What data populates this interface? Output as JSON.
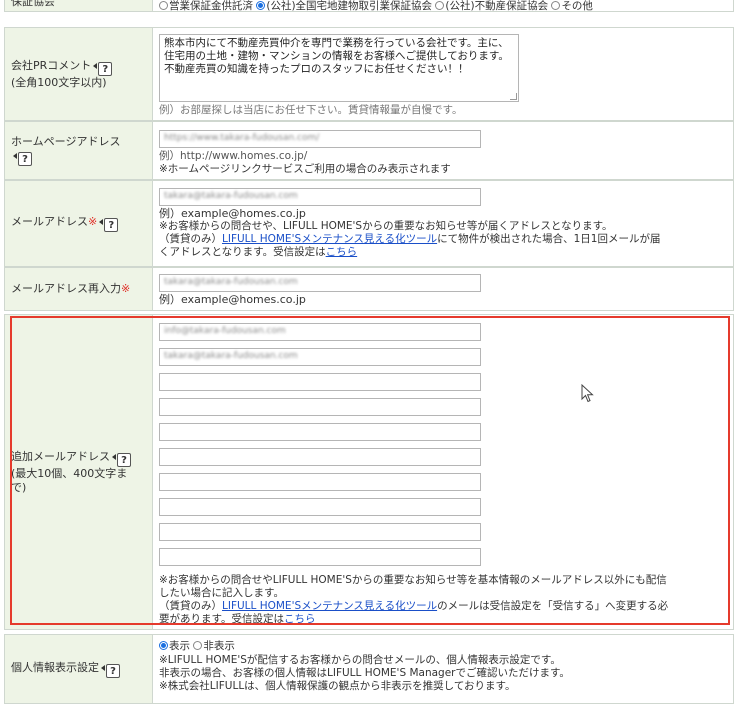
{
  "guarantee": {
    "label": "保証協会",
    "options": [
      {
        "label": "営業保証金供託済",
        "checked": false
      },
      {
        "label": "(公社)全国宅地建物取引業保証協会",
        "checked": true
      },
      {
        "label": "(公社)不動産保証協会",
        "checked": false
      },
      {
        "label": "その他",
        "checked": false
      }
    ]
  },
  "pr_comment": {
    "label_line1": "会社PRコメント",
    "label_line2": "(全角100文字以内)",
    "help": "?",
    "value": "熊本市内にて不動産売買仲介を専門で業務を行っている会社です。主に、住宅用の土地・建物・マンションの情報をお客様へご提供しております。不動産売買の知識を持ったプロのスタッフにお任せください！！",
    "example": "例）お部屋探しは当店にお任せ下さい。賃貸情報量が自慢です。"
  },
  "homepage": {
    "label": "ホームページアドレス",
    "help": "?",
    "value": "https://www.takara-fudousan.com/",
    "example": "例）http://www.homes.co.jp/",
    "note": "※ホームページリンクサービスご利用の場合のみ表示されます"
  },
  "email": {
    "label": "メールアドレス",
    "required_mark": "※",
    "help": "?",
    "value": "takara@takara-fudousan.com",
    "example": "例）example@homes.co.jp",
    "note1": "※お客様からの問合せや、LIFULL HOME'Sからの重要なお知らせ等が届くアドレスとなります。",
    "note2_prefix": "（賃貸のみ）",
    "note2_link": "LIFULL HOME'Sメンテナンス見える化ツール",
    "note2_suffix": "にて物件が検出された場合、1日1回メールが届",
    "note3_prefix": "くアドレスとなります。受信設定は",
    "note3_link": "こちら"
  },
  "email_confirm": {
    "label": "メールアドレス再入力",
    "required_mark": "※",
    "value": "takara@takara-fudousan.com",
    "example": "例）example@homes.co.jp"
  },
  "extra_email": {
    "label_line1": "追加メールアドレス",
    "label_line2": "(最大10個、400文字ま",
    "label_line3": "で)",
    "help": "?",
    "fields": [
      "info@takara-fudousan.com",
      "takara@takara-fudousan.com",
      "",
      "",
      "",
      "",
      "",
      "",
      "",
      ""
    ],
    "note1": "※お客様からの問合せやLIFULL HOME'Sからの重要なお知らせ等を基本情報のメールアドレス以外にも配信",
    "note2": "したい場合に記入します。",
    "note3_prefix": "（賃貸のみ）",
    "note3_link": "LIFULL HOME'Sメンテナンス見える化ツール",
    "note3_suffix": "のメールは受信設定を「受信する」へ変更する必",
    "note4_prefix": "要があります。受信設定は",
    "note4_link": "こちら"
  },
  "privacy": {
    "label": "個人情報表示設定",
    "help": "?",
    "option_show": "表示",
    "option_hide": "非表示",
    "show_checked": true,
    "note1": "※LIFULL HOME'Sが配信するお客様からの問合せメールの、個人情報表示設定です。",
    "note2": "非表示の場合、お客様の個人情報はLIFULL HOME'S Managerでご確認いただけます。",
    "note3": "※株式会社LIFULLは、個人情報保護の観点から非表示を推奨しております。"
  }
}
